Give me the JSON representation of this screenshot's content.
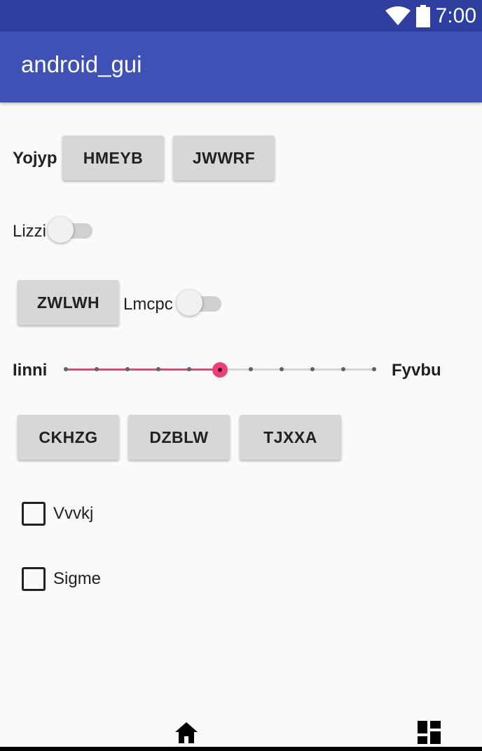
{
  "status_bar": {
    "time": "7:00",
    "icons": [
      "wifi-icon",
      "battery-icon"
    ]
  },
  "app_bar": {
    "title": "android_gui"
  },
  "row1": {
    "label": "Yojyp",
    "buttons": [
      "HMEYB",
      "JWWRF"
    ]
  },
  "row2": {
    "switch_label": "Lizzi",
    "switch_on": false
  },
  "row3": {
    "button": "ZWLWH",
    "switch_label": "Lmcpc",
    "switch_on": false
  },
  "slider": {
    "min_label": "Iinni",
    "max_label": "Fyvbu",
    "steps": 10,
    "value": 5,
    "accent": "#ec407a"
  },
  "row5": {
    "buttons": [
      "CKHZG",
      "DZBLW",
      "TJXXA"
    ]
  },
  "checkboxes": [
    {
      "label": "Vvvkj",
      "checked": false
    },
    {
      "label": "Sigme",
      "checked": false
    }
  ],
  "bottom_nav": {
    "icons": [
      "home-icon",
      "dashboard-icon"
    ]
  },
  "colors": {
    "primary": "#3f51b5",
    "primary_dark": "#2f3f9f",
    "background": "#fafafa",
    "button": "#d6d7d7"
  }
}
